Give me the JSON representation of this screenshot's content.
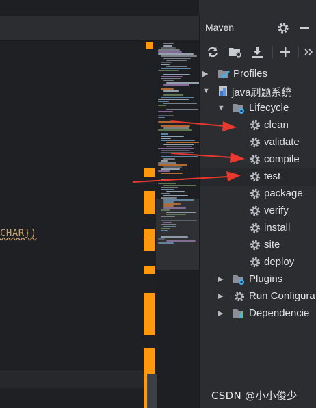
{
  "editor": {
    "code_fragment": "CHAR})"
  },
  "maven": {
    "title": "Maven",
    "tree": {
      "profiles": "Profiles",
      "project": "java刷题系统",
      "lifecycle": "Lifecycle",
      "phases": [
        "clean",
        "validate",
        "compile",
        "test",
        "package",
        "verify",
        "install",
        "site",
        "deploy"
      ],
      "plugins": "Plugins",
      "run_configurations": "Run Configura",
      "dependencies": "Dependencie"
    },
    "selected_phase": "test"
  },
  "watermark": "CSDN @小小俊少",
  "colors": {
    "accent_marker": "#ff9811",
    "annotation_arrow": "#e8382f",
    "panel_bg": "#2b2d30",
    "editor_bg": "#1f2023"
  },
  "icons": {
    "toolbar": [
      "reload-icon",
      "add-maven-project-icon",
      "download-sources-icon",
      "add-icon",
      "more-icon"
    ],
    "header": [
      "gear-icon",
      "minimize-icon"
    ]
  }
}
